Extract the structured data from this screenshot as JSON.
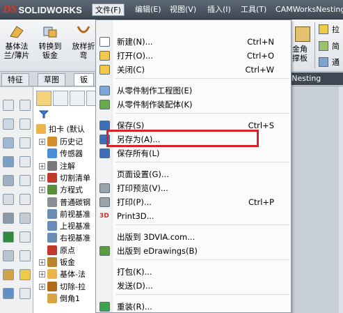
{
  "app": {
    "logo_mark": "DS",
    "logo_text": "SOLIDWORKS"
  },
  "menubar": {
    "items": [
      "文件(F)",
      "编辑(E)",
      "视图(V)",
      "插入(I)",
      "工具(T)",
      "CAMWorksNesting"
    ]
  },
  "command_manager": {
    "buttons": [
      {
        "label_line1": "基体法",
        "label_line2": "兰/薄片",
        "icon": "base-flange-icon"
      },
      {
        "label_line1": "转换到",
        "label_line2": "钣金",
        "icon": "convert-to-sheetmetal-icon"
      },
      {
        "label_line1": "放样折",
        "label_line2": "弯",
        "icon": "lofted-bend-icon"
      }
    ],
    "right_labels": [
      "拉",
      "简",
      "通"
    ],
    "right_partial_label": {
      "line1": "金角",
      "line2": "撑板"
    }
  },
  "tabs": [
    "特征",
    "草图",
    "钣"
  ],
  "cam_tab": "s Nesting",
  "feature_tree": {
    "root": "扣卡 (默认",
    "items": [
      {
        "expander": "+",
        "label": "历史记",
        "icon": "history-icon"
      },
      {
        "expander": "",
        "label": "传感器",
        "icon": "sensor-icon"
      },
      {
        "expander": "+",
        "label": "注解",
        "icon": "annotation-icon"
      },
      {
        "expander": "+",
        "label": "切割清单",
        "icon": "cut-list-icon"
      },
      {
        "expander": "+",
        "label": "方程式",
        "icon": "equation-icon"
      },
      {
        "expander": "",
        "label": "普通碳钢",
        "icon": "material-icon"
      },
      {
        "expander": "",
        "label": "前视基准",
        "icon": "plane-icon"
      },
      {
        "expander": "",
        "label": "上视基准",
        "icon": "plane-icon"
      },
      {
        "expander": "",
        "label": "右视基准",
        "icon": "plane-icon"
      },
      {
        "expander": "",
        "label": "原点",
        "icon": "origin-icon"
      },
      {
        "expander": "+",
        "label": "钣金",
        "icon": "sheetmetal-icon"
      },
      {
        "expander": "+",
        "label": "基体-法",
        "icon": "base-flange-icon"
      },
      {
        "expander": "+",
        "label": "切除-拉",
        "icon": "cut-extrude-icon"
      },
      {
        "expander": "",
        "label": "倒角1",
        "icon": "chamfer-icon"
      }
    ]
  },
  "file_menu": {
    "items": [
      {
        "label": "新建(N)...",
        "shortcut": "Ctrl+N",
        "icon": "new-document-icon"
      },
      {
        "label": "打开(O)...",
        "shortcut": "Ctrl+O",
        "icon": "open-folder-icon"
      },
      {
        "label": "关闭(C)",
        "shortcut": "Ctrl+W",
        "icon": "close-folder-icon"
      },
      {
        "label": "从零件制作工程图(E)",
        "shortcut": "",
        "icon": "make-drawing-icon"
      },
      {
        "label": "从零件制作装配体(K)",
        "shortcut": "",
        "icon": "make-assembly-icon"
      },
      {
        "label": "保存(S)",
        "shortcut": "Ctrl+S",
        "icon": "save-icon"
      },
      {
        "label": "另存为(A)...",
        "shortcut": "",
        "icon": "save-as-icon"
      },
      {
        "label": "保存所有(L)",
        "shortcut": "",
        "icon": "save-all-icon"
      },
      {
        "label": "页面设置(G)...",
        "shortcut": "",
        "icon": ""
      },
      {
        "label": "打印预览(V)...",
        "shortcut": "",
        "icon": "print-preview-icon"
      },
      {
        "label": "打印(P)...",
        "shortcut": "Ctrl+P",
        "icon": "print-icon"
      },
      {
        "label": "Print3D...",
        "shortcut": "",
        "icon": "print3d-icon"
      },
      {
        "label": "出版到 3DVIA.com...",
        "shortcut": "",
        "icon": ""
      },
      {
        "label": "出版到 eDrawings(B)",
        "shortcut": "",
        "icon": "edrawings-icon"
      },
      {
        "label": "打包(K)...",
        "shortcut": "",
        "icon": ""
      },
      {
        "label": "发送(D)...",
        "shortcut": "",
        "icon": ""
      },
      {
        "label": "重装(R)...",
        "shortcut": "",
        "icon": "reload-icon"
      }
    ],
    "icon_3d_text": "3D",
    "highlighted_item": "另存为(A)...",
    "highlight_color": "#d8222a"
  }
}
